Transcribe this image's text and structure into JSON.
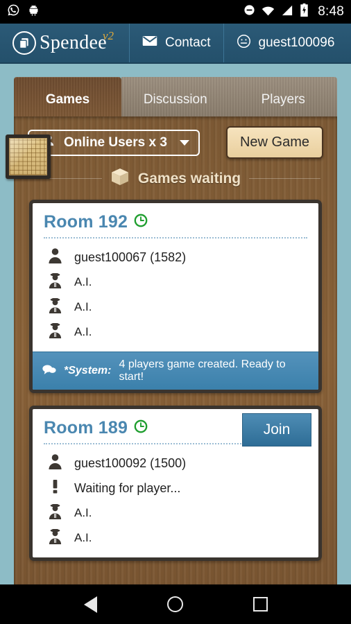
{
  "status_bar": {
    "time": "8:48",
    "left_icons": [
      "whatsapp-icon",
      "android-icon"
    ],
    "right_icons": [
      "do-not-disturb-icon",
      "wifi-icon",
      "cellular-signal-icon",
      "battery-charging-icon"
    ]
  },
  "header": {
    "brand_name": "Spendee",
    "brand_version": "v2",
    "contact_label": "Contact",
    "user_label": "guest100096"
  },
  "tabs": [
    {
      "label": "Games",
      "active": true
    },
    {
      "label": "Discussion",
      "active": false
    },
    {
      "label": "Players",
      "active": false
    }
  ],
  "toolbar": {
    "online_users_label": "Online Users x 3",
    "new_game_label": "New Game"
  },
  "section": {
    "title": "Games waiting"
  },
  "rooms": [
    {
      "title": "Room 192",
      "has_timer": true,
      "join_label": null,
      "players": [
        {
          "icon": "person-icon",
          "label": "guest100067 (1582)"
        },
        {
          "icon": "ai-agent-icon",
          "label": "A.I."
        },
        {
          "icon": "ai-agent-icon",
          "label": "A.I."
        },
        {
          "icon": "ai-agent-icon",
          "label": "A.I."
        }
      ],
      "system_message": {
        "prefix": "*System:",
        "text": "4 players game created. Ready to start!"
      }
    },
    {
      "title": "Room 189",
      "has_timer": true,
      "join_label": "Join",
      "players": [
        {
          "icon": "person-icon",
          "label": "guest100092 (1500)"
        },
        {
          "icon": "waiting-icon",
          "label": "Waiting for player..."
        },
        {
          "icon": "ai-agent-icon",
          "label": "A.I."
        },
        {
          "icon": "ai-agent-icon",
          "label": "A.I."
        }
      ],
      "system_message": null
    }
  ],
  "nav_bar": {
    "back_label": "back-icon",
    "home_label": "home-icon",
    "recents_label": "recents-icon"
  },
  "colors": {
    "header_blue": "#2b5a77",
    "page_background": "#8dbcc6",
    "wood_brown": "#8a6238",
    "accent_blue": "#4a87b0",
    "join_blue": "#3b80ab",
    "timer_green": "#1f9e2f",
    "cream": "#f0e2c8",
    "gold": "#e0a93a"
  }
}
